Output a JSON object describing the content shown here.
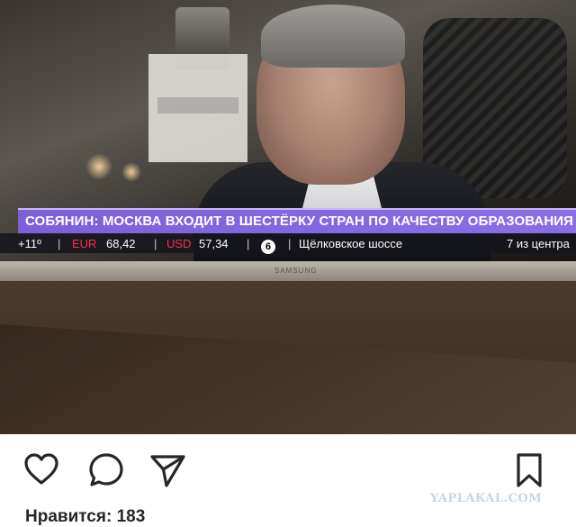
{
  "tv": {
    "ticker": "СОБЯНИН: МОСКВА ВХОДИТ В ШЕСТЁРКУ СТРАН ПО КАЧЕСТВУ ОБРАЗОВАНИЯ",
    "temperature": "+11º",
    "eur_label": "EUR",
    "eur_value": "68,42",
    "usd_label": "USD",
    "usd_value": "57,34",
    "traffic_score": "6",
    "location": "Щёлковское шоссе",
    "distance": "7 из центра",
    "brand": "SAMSUNG"
  },
  "actions": {
    "like_icon": "heart-icon",
    "comment_icon": "comment-icon",
    "share_icon": "send-icon",
    "save_icon": "bookmark-icon"
  },
  "watermark": "YAPLAKAL.COM",
  "likes_text": "Нравится: 183",
  "colors": {
    "ticker_bg": "#8b6ee6",
    "currency_label": "#ff2d55"
  }
}
